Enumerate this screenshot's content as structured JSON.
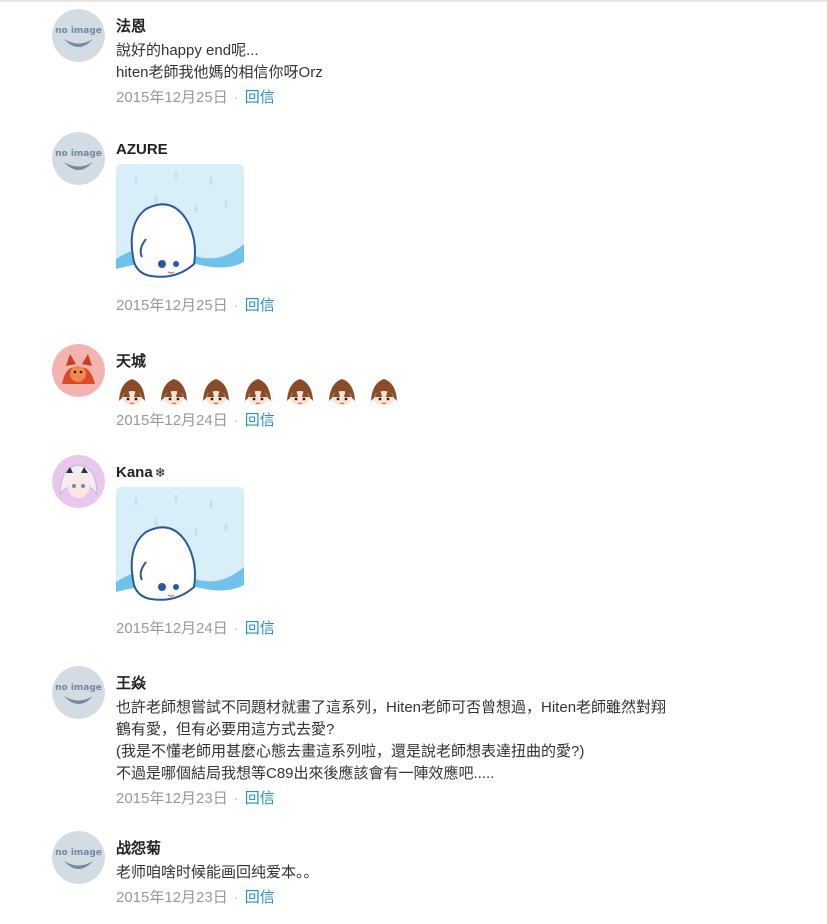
{
  "comments": [
    {
      "name": "法恩",
      "avatar": "no-image-avatar",
      "lines": [
        "說好的happy end呢...",
        "hiten老師我他媽的相信你呀Orz"
      ],
      "date": "2015年12月25日",
      "reply": "回信"
    },
    {
      "name": "AZURE",
      "avatar": "no-image-avatar",
      "sticker": "ghost-sticker",
      "date": "2015年12月25日",
      "reply": "回信"
    },
    {
      "name": "天城",
      "avatar": "fox-avatar",
      "emoji_count": 7,
      "emoji": "brown-hair-face-emoji",
      "date": "2015年12月24日",
      "reply": "回信"
    },
    {
      "name": "Kana",
      "name_suffix": "❄",
      "avatar": "anime-girl-avatar",
      "sticker": "ghost-sticker",
      "date": "2015年12月24日",
      "reply": "回信"
    },
    {
      "name": "王焱",
      "avatar": "no-image-avatar",
      "lines": [
        "也許老師想嘗試不同題材就畫了這系列，Hiten老師可否曾想過，Hiten老師雖然對翔",
        "鶴有愛，但有必要用這方式去愛?",
        "(我是不懂老師用甚麼心態去畫這系列啦，還是說老師想表達扭曲的愛?)",
        "不過是哪個結局我想等C89出來後應該會有一陣效應吧....."
      ],
      "date": "2015年12月23日",
      "reply": "回信"
    },
    {
      "name": "战怨菊",
      "avatar": "no-image-avatar",
      "lines": [
        "老师咱啥时候能画回纯爱本。。"
      ],
      "date": "2015年12月23日",
      "reply": "回信"
    }
  ],
  "separator": "·",
  "no_image_text": "no image",
  "colors": {
    "reply_link": "#2a8fc4",
    "meta": "#999999",
    "name": "#222222"
  }
}
